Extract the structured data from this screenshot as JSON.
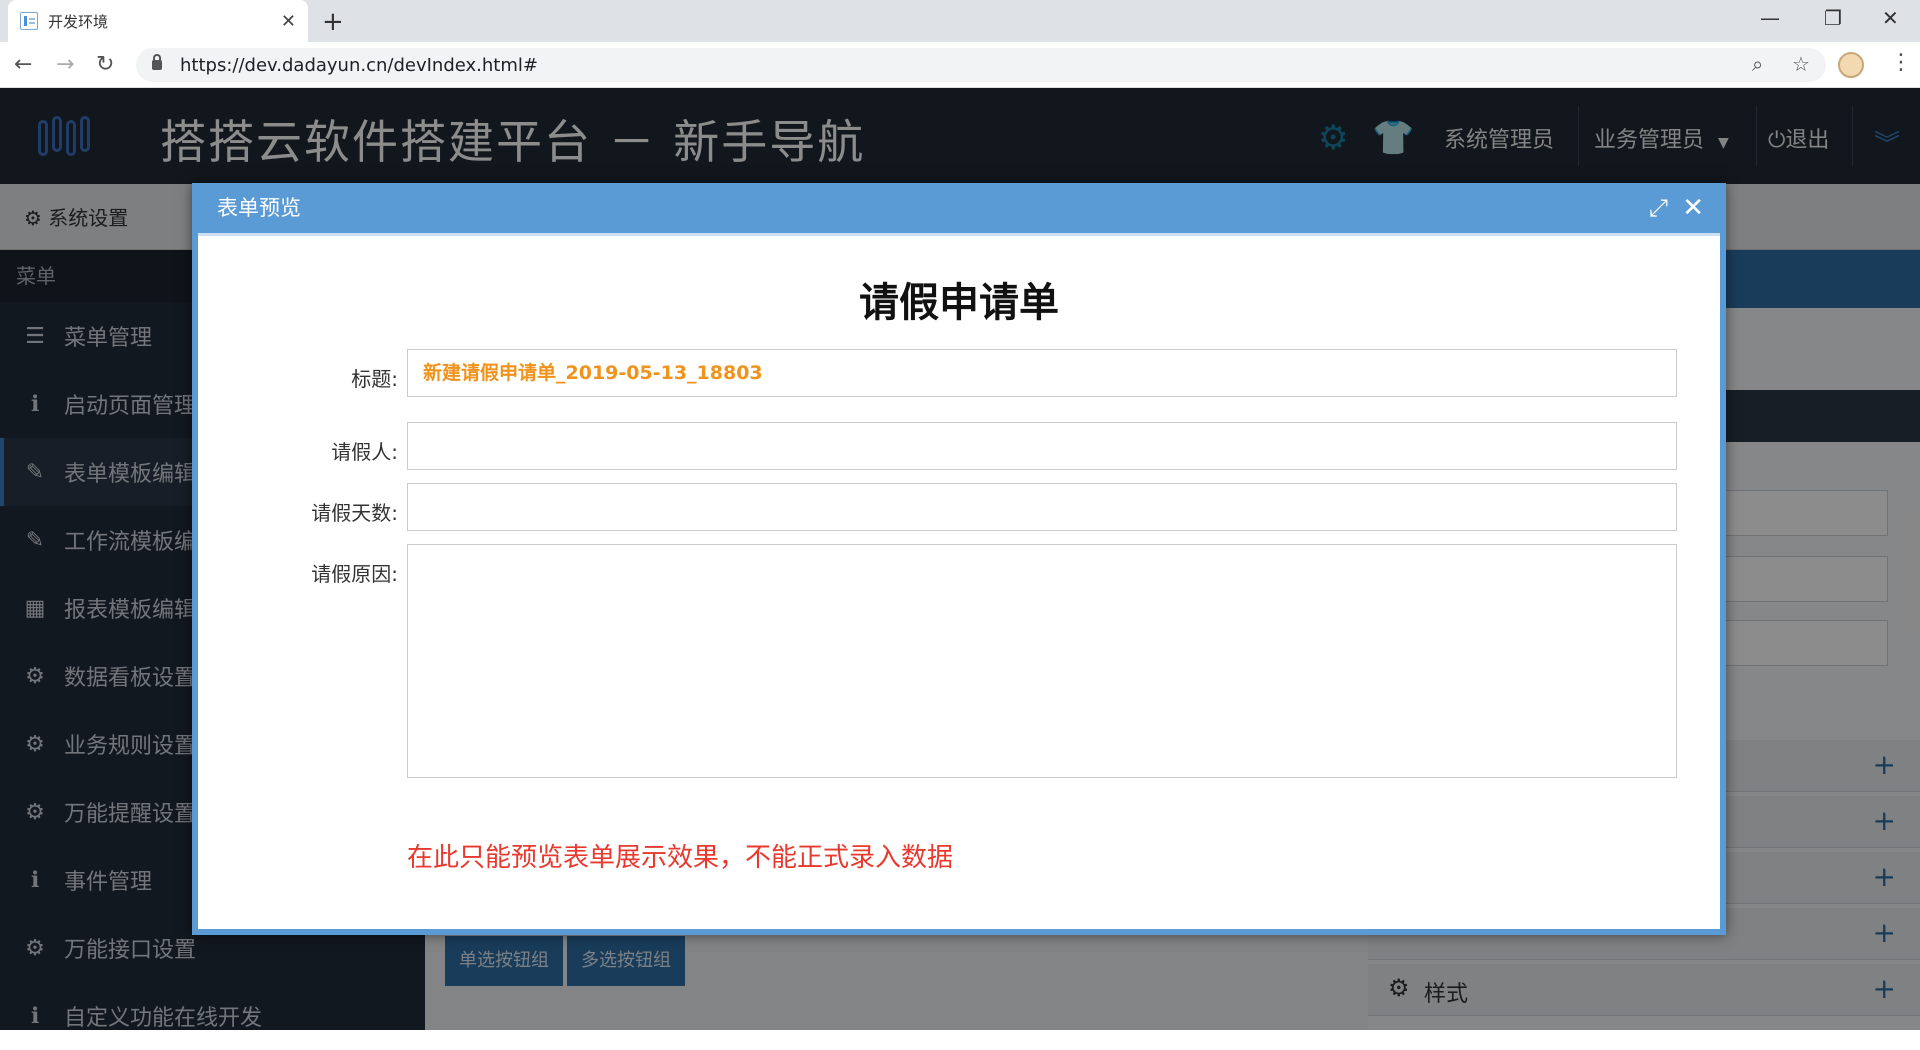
{
  "browser": {
    "tab_title": "开发环境",
    "tab_close": "✕",
    "new_tab": "+",
    "url": "https://dev.dadayun.cn/devIndex.html#",
    "minimize": "—",
    "restore": "❐",
    "close": "✕"
  },
  "app": {
    "title": "搭搭云软件搭建平台 － 新手导航",
    "header": {
      "system_admin": "系统管理员",
      "business_admin": "业务管理员",
      "logout": "退出"
    },
    "toolbar_label": "系统设置",
    "sidebar": {
      "heading": "菜单",
      "items": [
        {
          "label": "菜单管理",
          "icon": "list-icon"
        },
        {
          "label": "启动页面管理",
          "icon": "info-icon"
        },
        {
          "label": "表单模板编辑",
          "icon": "edit-icon"
        },
        {
          "label": "工作流模板编辑",
          "icon": "edit-icon"
        },
        {
          "label": "报表模板编辑",
          "icon": "table-icon"
        },
        {
          "label": "数据看板设置",
          "icon": "gear-icon"
        },
        {
          "label": "业务规则设置",
          "icon": "gear-icon"
        },
        {
          "label": "万能提醒设置",
          "icon": "gear-icon"
        },
        {
          "label": "事件管理",
          "icon": "info-icon"
        },
        {
          "label": "万能接口设置",
          "icon": "gear-icon"
        },
        {
          "label": "自定义功能在线开发",
          "icon": "info-icon"
        }
      ]
    },
    "bottom_buttons": [
      "单选按钮组",
      "多选按钮组"
    ],
    "right_panel": {
      "style_label": "样式"
    }
  },
  "modal": {
    "title": "表单预览",
    "form_title": "请假申请单",
    "fields": {
      "title_label": "标题:",
      "title_value": "新建请假申请单_2019-05-13_18803",
      "applicant_label": "请假人:",
      "applicant_value": "",
      "days_label": "请假天数:",
      "days_value": "",
      "reason_label": "请假原因:",
      "reason_value": ""
    },
    "notice": "在此只能预览表单展示效果，不能正式录入数据"
  }
}
